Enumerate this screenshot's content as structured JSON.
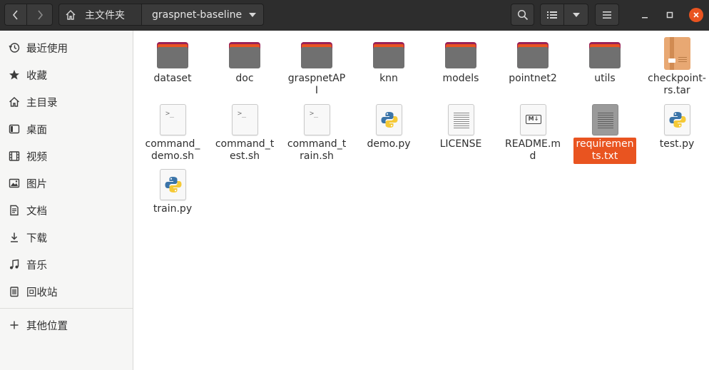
{
  "header": {
    "path_home_label": "主文件夹",
    "path_current_label": "graspnet-baseline"
  },
  "sidebar": {
    "items": [
      {
        "label": "最近使用",
        "icon": "clock-icon"
      },
      {
        "label": "收藏",
        "icon": "star-icon"
      },
      {
        "label": "主目录",
        "icon": "home-icon"
      },
      {
        "label": "桌面",
        "icon": "desktop-icon"
      },
      {
        "label": "视频",
        "icon": "video-icon"
      },
      {
        "label": "图片",
        "icon": "picture-icon"
      },
      {
        "label": "文档",
        "icon": "document-icon"
      },
      {
        "label": "下载",
        "icon": "download-icon"
      },
      {
        "label": "音乐",
        "icon": "music-icon"
      },
      {
        "label": "回收站",
        "icon": "trash-icon"
      },
      {
        "label": "其他位置",
        "icon": "plus-icon"
      }
    ]
  },
  "files": [
    {
      "name": "dataset",
      "type": "folder"
    },
    {
      "name": "doc",
      "type": "folder"
    },
    {
      "name": "graspnetAPI",
      "type": "folder"
    },
    {
      "name": "knn",
      "type": "folder"
    },
    {
      "name": "models",
      "type": "folder"
    },
    {
      "name": "pointnet2",
      "type": "folder"
    },
    {
      "name": "utils",
      "type": "folder"
    },
    {
      "name": "checkpoint-rs.tar",
      "type": "archive"
    },
    {
      "name": "command_demo.sh",
      "type": "shell"
    },
    {
      "name": "command_test.sh",
      "type": "shell"
    },
    {
      "name": "command_train.sh",
      "type": "shell"
    },
    {
      "name": "demo.py",
      "type": "python"
    },
    {
      "name": "LICENSE",
      "type": "text"
    },
    {
      "name": "README.md",
      "type": "markdown"
    },
    {
      "name": "requirements.txt",
      "type": "text",
      "selected": true
    },
    {
      "name": "test.py",
      "type": "python"
    },
    {
      "name": "train.py",
      "type": "python"
    }
  ],
  "colors": {
    "accent": "#e95420",
    "folder_dark": "#9b2257",
    "folder_front": "#707070",
    "headerbar": "#2d2d2d",
    "sidebar": "#f6f6f5"
  }
}
